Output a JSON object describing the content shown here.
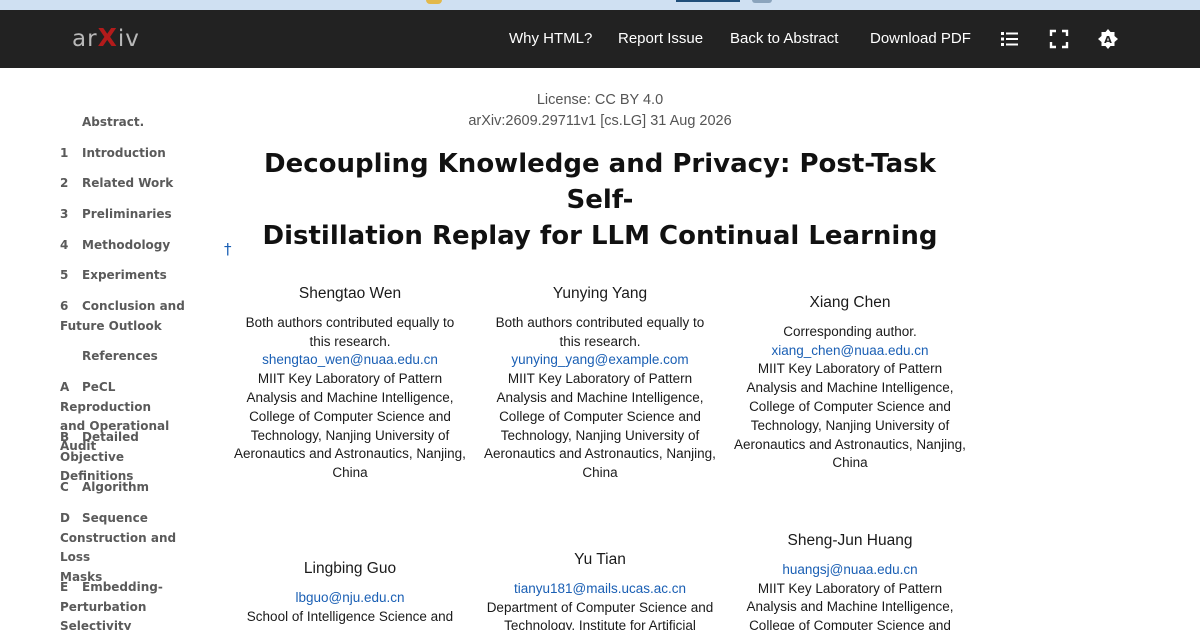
{
  "nav": {
    "logo_prefix": "ar",
    "logo_x": "X",
    "logo_suffix": "iv",
    "links": [
      "Why HTML?",
      "Report Issue",
      "Back to Abstract",
      "Download PDF"
    ],
    "icons": [
      "toc-list-icon",
      "fullscreen-icon",
      "theme-toggle-icon"
    ]
  },
  "toc": {
    "abstract": "Abstract.",
    "items": [
      {
        "num": "1",
        "label": "Introduction"
      },
      {
        "num": "2",
        "label": "Related Work"
      },
      {
        "num": "3",
        "label": "Preliminaries"
      },
      {
        "num": "4",
        "label": "Methodology"
      },
      {
        "num": "5",
        "label": "Experiments"
      },
      {
        "num": "6",
        "label": "Conclusion and",
        "label2": "Future Outlook"
      },
      {
        "num": "",
        "label": "References"
      },
      {
        "num": "A",
        "label": "PeCL Reproduction",
        "label2": "and Operational Audit"
      },
      {
        "num": "B",
        "label": "Detailed Objective",
        "label2": "Definitions"
      },
      {
        "num": "C",
        "label": "Algorithm"
      },
      {
        "num": "D",
        "label": "Sequence",
        "label2": "Construction and Loss",
        "label3": "Masks"
      },
      {
        "num": "E",
        "label": "Embedding-",
        "label2": "Perturbation",
        "label3": "Selectivity Diagnostic"
      }
    ]
  },
  "paper": {
    "license": "License: CC BY 4.0",
    "arxiv_id": "arXiv:2609.29711v1 [cs.LG] 31 Aug 2026",
    "title_line1": "Decoupling Knowledge and Privacy: Post-Task Self-",
    "title_line2": "Distillation Replay for LLM Continual Learning",
    "dagger": "†"
  },
  "authors": [
    {
      "name": "Shengtao Wen",
      "lines": [
        "Both authors contributed equally to",
        "this research."
      ],
      "email": "shengtao_wen@nuaa.edu.cn",
      "affil": [
        "MIIT Key Laboratory of Pattern",
        "Analysis and Machine Intelligence,",
        "College of Computer Science and",
        "Technology, Nanjing University of",
        "Aeronautics and Astronautics, Nanjing,",
        "China"
      ]
    },
    {
      "name": "Yunying Yang",
      "lines": [
        "Both authors contributed equally to",
        "this research."
      ],
      "email": "yunying_yang@example.com",
      "affil": [
        "MIIT Key Laboratory of Pattern",
        "Analysis and Machine Intelligence,",
        "College of Computer Science and",
        "Technology, Nanjing University of",
        "Aeronautics and Astronautics, Nanjing,",
        "China"
      ]
    },
    {
      "name": "Xiang Chen",
      "lines": [
        "Corresponding author."
      ],
      "email": "xiang_chen@nuaa.edu.cn",
      "affil": [
        "MIIT Key Laboratory of Pattern",
        "Analysis and Machine Intelligence,",
        "College of Computer Science and",
        "Technology, Nanjing University of",
        "Aeronautics and Astronautics, Nanjing,",
        "China"
      ]
    },
    {
      "name": "Lingbing Guo",
      "lines": [],
      "email": "lbguo@nju.edu.cn",
      "affil": [
        "School of Intelligence Science and"
      ]
    },
    {
      "name": "Yu Tian",
      "lines": [],
      "email": "tianyu181@mails.ucas.ac.cn",
      "affil": [
        "Department of Computer Science and",
        "Technology, Institute for Artificial"
      ]
    },
    {
      "name": "Sheng-Jun Huang",
      "lines": [],
      "email": "huangsj@nuaa.edu.cn",
      "affil": [
        "MIIT Key Laboratory of Pattern",
        "Analysis and Machine Intelligence,",
        "College of Computer Science and"
      ]
    }
  ]
}
